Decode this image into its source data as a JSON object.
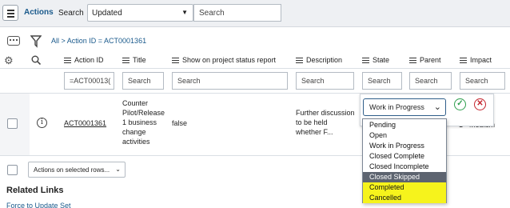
{
  "header": {
    "title": "Actions",
    "search_label": "Search",
    "search_field": "Updated",
    "search_placeholder": "Search"
  },
  "breadcrumb": "All > Action ID = ACT0001361",
  "columns": [
    "Action ID",
    "Title",
    "Show on project status report",
    "Description",
    "State",
    "Parent",
    "Impact"
  ],
  "column_search": {
    "action_id": "=ACT00013(",
    "title": "Search",
    "show_on_report": "Search",
    "description": "Search",
    "state": "Search",
    "parent": "Search",
    "impact": "Search"
  },
  "row": {
    "action_id": "ACT0001361",
    "title_lines": [
      "Counter",
      "Pilot/Release",
      "1 business",
      "change",
      "activities"
    ],
    "show_on_report": "false",
    "description_lines": [
      "Further discussion",
      "to be held",
      "whether F..."
    ],
    "impact": "1 - Medium"
  },
  "state_editor": {
    "selected": "Work in Progress",
    "options": [
      "Pending",
      "Open",
      "Work in Progress",
      "Closed Complete",
      "Closed Incomplete",
      "Closed Skipped",
      "Completed",
      "Cancelled"
    ],
    "selected_option_index": 5,
    "highlighted_option_indexes": [
      6,
      7
    ],
    "highlight_color": "#f6f31c",
    "selected_option_color": "#5d6470"
  },
  "bulk_actions": "Actions on selected rows...",
  "related_links": {
    "title": "Related Links",
    "items": [
      "Force to Update Set"
    ]
  },
  "colors": {
    "accent": "#1a5a8c",
    "ok": "#2e9e4d",
    "cancel": "#c4232c"
  },
  "icons": [
    "hamburger-icon",
    "chat-icon",
    "funnel-icon",
    "gear-icon",
    "search-icon",
    "info-icon",
    "check-circle-icon",
    "x-circle-icon",
    "chevron-down-icon"
  ]
}
